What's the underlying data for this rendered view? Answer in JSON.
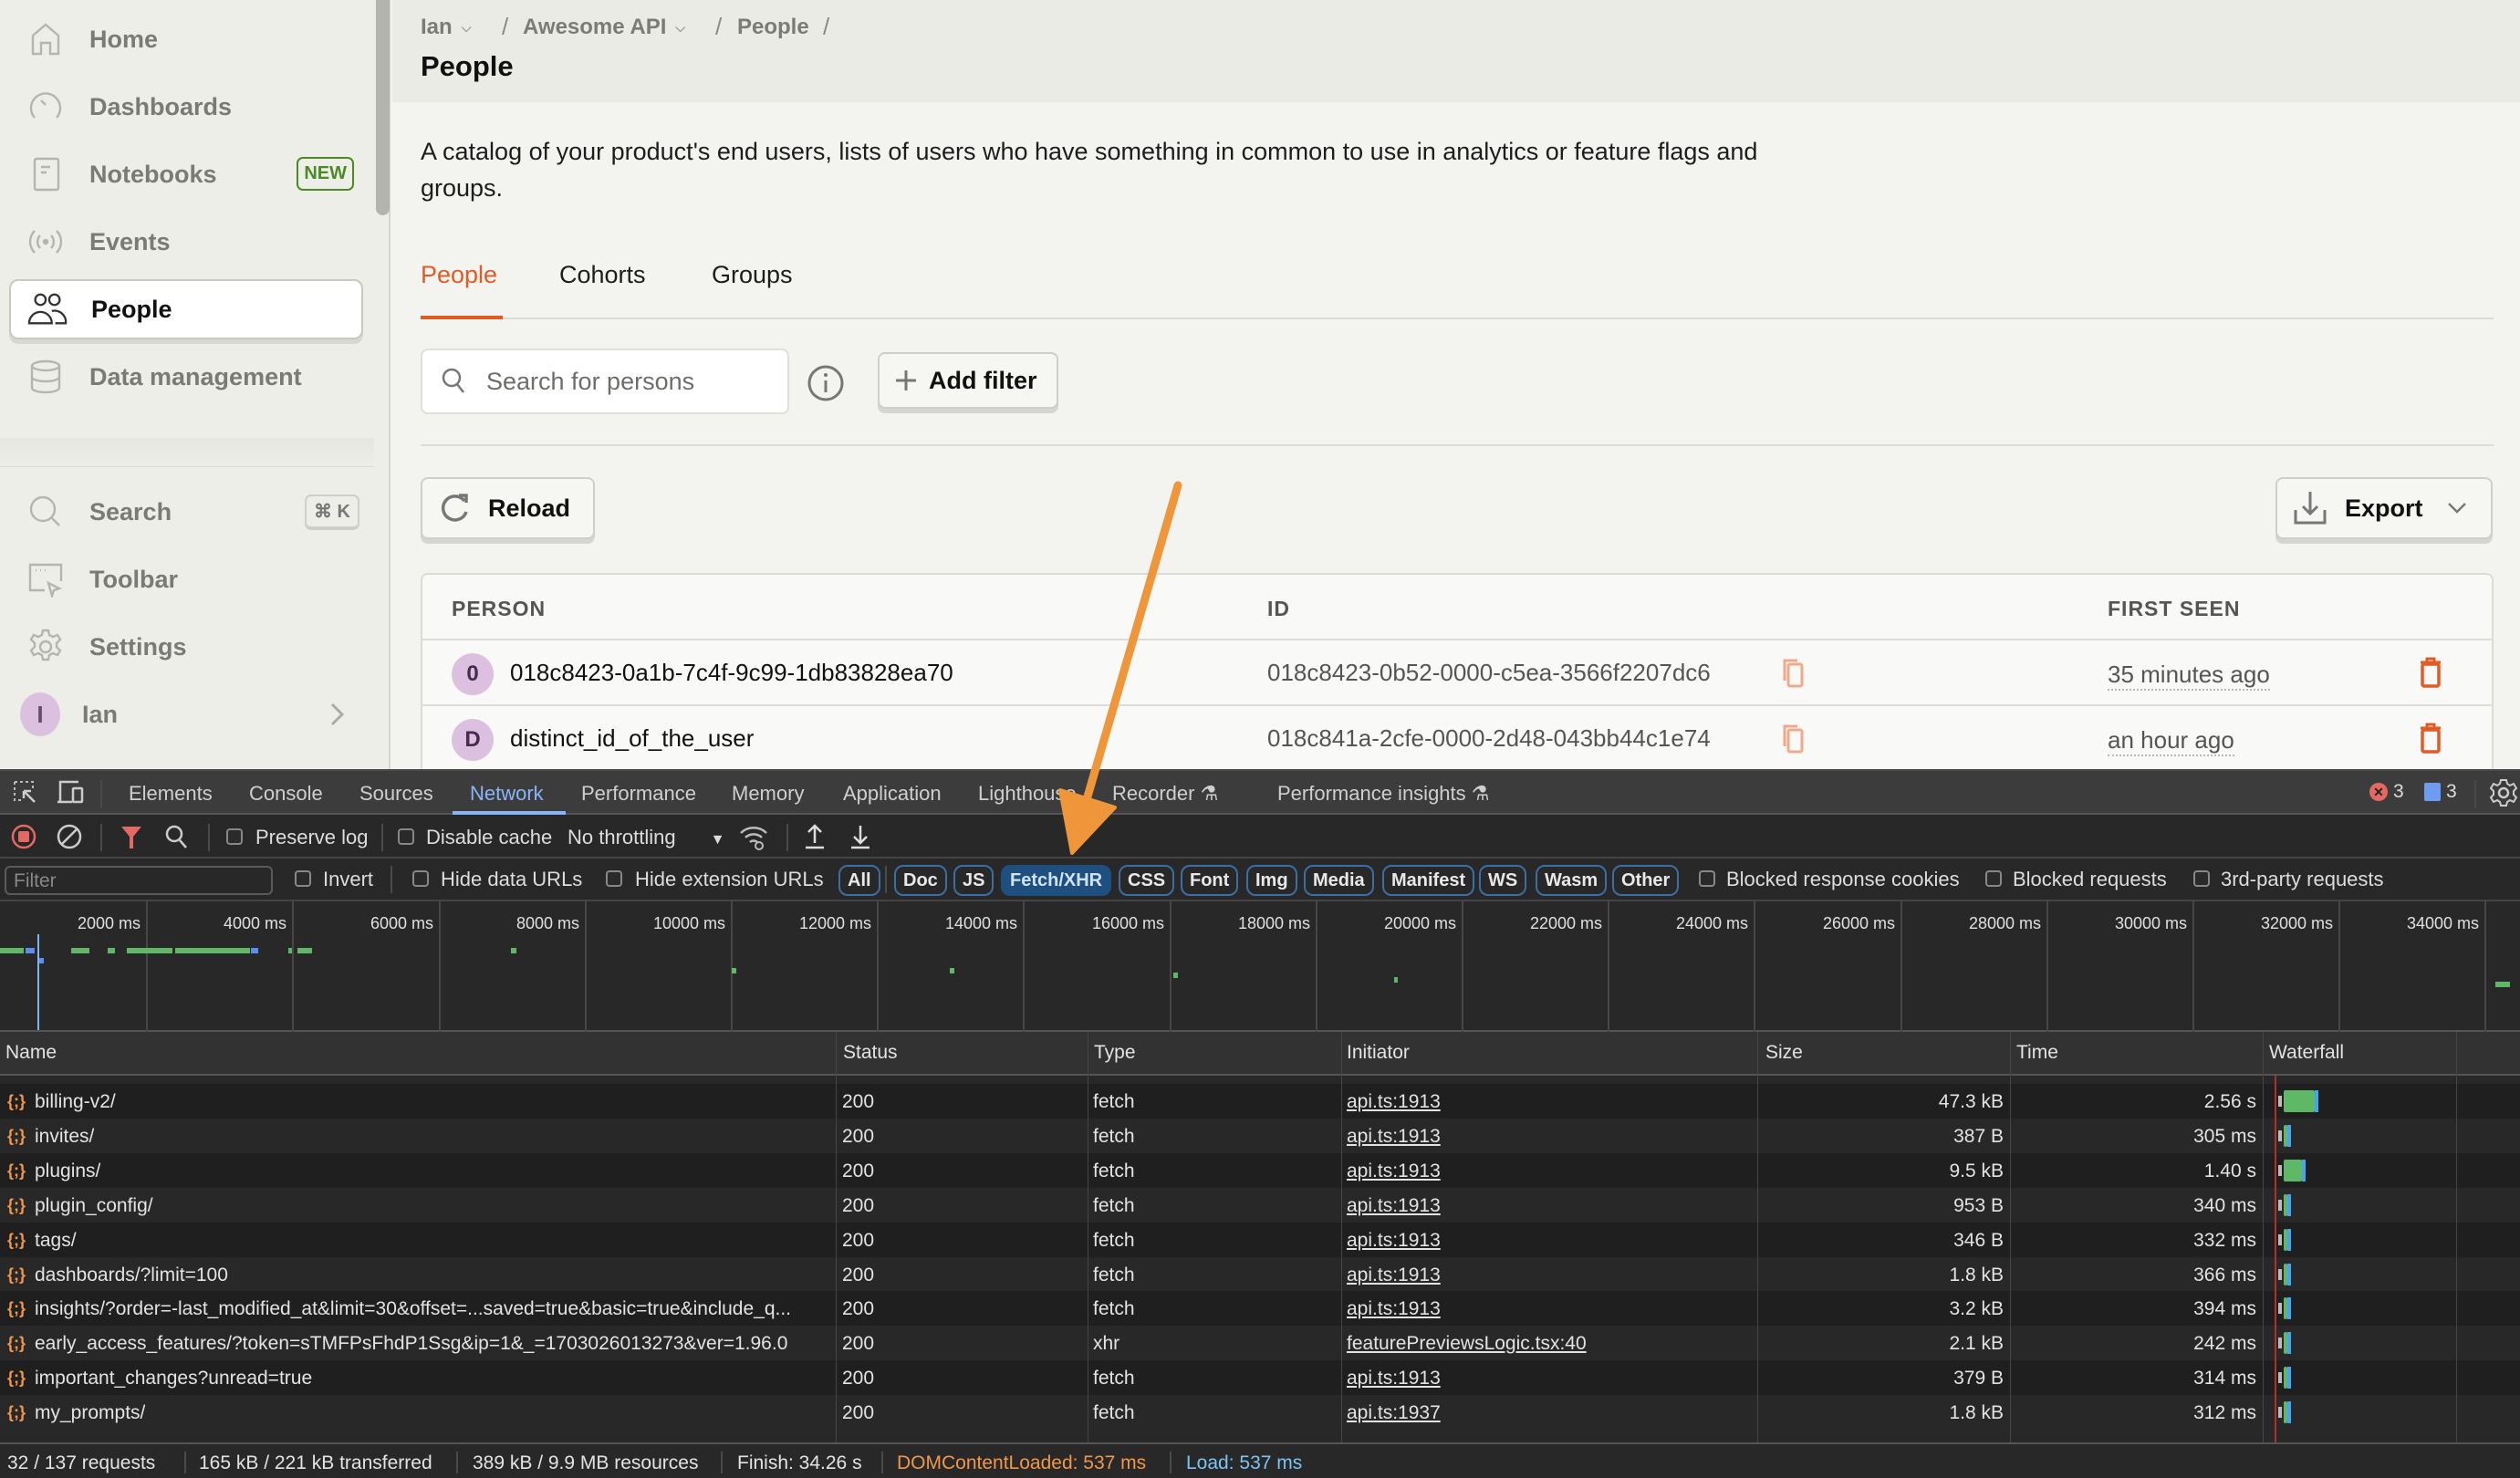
{
  "sidebar": {
    "items": [
      {
        "label": "Home",
        "icon": "home-icon"
      },
      {
        "label": "Dashboards",
        "icon": "gauge-icon"
      },
      {
        "label": "Notebooks",
        "icon": "notebook-icon",
        "badge": "NEW"
      },
      {
        "label": "Events",
        "icon": "broadcast-icon"
      },
      {
        "label": "People",
        "icon": "people-icon",
        "active": true
      },
      {
        "label": "Data management",
        "icon": "database-icon"
      }
    ],
    "bottom_items": [
      {
        "label": "Search",
        "icon": "search-icon",
        "shortcut": "⌘ K"
      },
      {
        "label": "Toolbar",
        "icon": "toolbar-icon"
      },
      {
        "label": "Settings",
        "icon": "gear-icon"
      },
      {
        "label": "Ian",
        "avatar_initial": "I"
      }
    ]
  },
  "breadcrumb": {
    "items": [
      "Ian",
      "Awesome API",
      "People"
    ],
    "separator": "/"
  },
  "page": {
    "title": "People",
    "description": "A catalog of your product's end users, lists of users who have something in common to use in analytics or feature flags and groups.",
    "tabs": [
      {
        "label": "People",
        "active": true
      },
      {
        "label": "Cohorts"
      },
      {
        "label": "Groups"
      }
    ],
    "search_placeholder": "Search for persons",
    "add_filter_label": "Add filter",
    "reload_label": "Reload",
    "export_label": "Export",
    "accent_color": "#e25a26"
  },
  "people_table": {
    "columns": [
      "PERSON",
      "ID",
      "FIRST SEEN"
    ],
    "rows": [
      {
        "initial": "0",
        "person": "018c8423-0a1b-7c4f-9c99-1db83828ea70",
        "id": "018c8423-0b52-0000-c5ea-3566f2207dc6",
        "first_seen": "35 minutes ago"
      },
      {
        "initial": "D",
        "person": "distinct_id_of_the_user",
        "id": "018c841a-2cfe-0000-2d48-043bb44c1e74",
        "first_seen": "an hour ago"
      }
    ]
  },
  "devtools": {
    "tabs": [
      "Elements",
      "Console",
      "Sources",
      "Network",
      "Performance",
      "Memory",
      "Application",
      "Lighthouse",
      "Recorder",
      "Performance insights"
    ],
    "active_tab": "Network",
    "error_count": "3",
    "message_count": "3",
    "toolbar": {
      "preserve_log": "Preserve log",
      "disable_cache": "Disable cache",
      "throttling": "No throttling"
    },
    "filter": {
      "placeholder": "Filter",
      "invert": "Invert",
      "hide_data_urls": "Hide data URLs",
      "hide_extension_urls": "Hide extension URLs",
      "types": [
        "All",
        "Doc",
        "JS",
        "Fetch/XHR",
        "CSS",
        "Font",
        "Img",
        "Media",
        "Manifest",
        "WS",
        "Wasm",
        "Other"
      ],
      "active_type": "Fetch/XHR",
      "blocked_response_cookies": "Blocked response cookies",
      "blocked_requests": "Blocked requests",
      "third_party": "3rd-party requests"
    },
    "overview_ticks": [
      "2000 ms",
      "4000 ms",
      "6000 ms",
      "8000 ms",
      "10000 ms",
      "12000 ms",
      "14000 ms",
      "16000 ms",
      "18000 ms",
      "20000 ms",
      "22000 ms",
      "24000 ms",
      "26000 ms",
      "28000 ms",
      "30000 ms",
      "32000 ms",
      "34000 ms"
    ],
    "columns": [
      "Name",
      "Status",
      "Type",
      "Initiator",
      "Size",
      "Time",
      "Waterfall"
    ],
    "requests": [
      {
        "name": "billing-v2/",
        "status": "200",
        "type": "fetch",
        "initiator": "api.ts:1913",
        "size": "47.3 kB",
        "time": "2.56 s"
      },
      {
        "name": "invites/",
        "status": "200",
        "type": "fetch",
        "initiator": "api.ts:1913",
        "size": "387 B",
        "time": "305 ms"
      },
      {
        "name": "plugins/",
        "status": "200",
        "type": "fetch",
        "initiator": "api.ts:1913",
        "size": "9.5 kB",
        "time": "1.40 s"
      },
      {
        "name": "plugin_config/",
        "status": "200",
        "type": "fetch",
        "initiator": "api.ts:1913",
        "size": "953 B",
        "time": "340 ms"
      },
      {
        "name": "tags/",
        "status": "200",
        "type": "fetch",
        "initiator": "api.ts:1913",
        "size": "346 B",
        "time": "332 ms"
      },
      {
        "name": "dashboards/?limit=100",
        "status": "200",
        "type": "fetch",
        "initiator": "api.ts:1913",
        "size": "1.8 kB",
        "time": "366 ms"
      },
      {
        "name": "insights/?order=-last_modified_at&limit=30&offset=...saved=true&basic=true&include_q...",
        "status": "200",
        "type": "fetch",
        "initiator": "api.ts:1913",
        "size": "3.2 kB",
        "time": "394 ms"
      },
      {
        "name": "early_access_features/?token=sTMFPsFhdP1Ssg&ip=1&_=1703026013273&ver=1.96.0",
        "status": "200",
        "type": "xhr",
        "initiator": "featurePreviewsLogic.tsx:40",
        "size": "2.1 kB",
        "time": "242 ms"
      },
      {
        "name": "important_changes?unread=true",
        "status": "200",
        "type": "fetch",
        "initiator": "api.ts:1913",
        "size": "379 B",
        "time": "314 ms"
      },
      {
        "name": "my_prompts/",
        "status": "200",
        "type": "fetch",
        "initiator": "api.ts:1937",
        "size": "1.8 kB",
        "time": "312 ms"
      }
    ],
    "footer": {
      "requests": "32 / 137 requests",
      "transferred": "165 kB / 221 kB transferred",
      "resources": "389 kB / 9.9 MB resources",
      "finish": "Finish: 34.26 s",
      "dom_content_loaded": "DOMContentLoaded: 537 ms",
      "load": "Load: 537 ms",
      "dcl_color": "#f0974a",
      "load_color": "#7cc4f5"
    }
  },
  "annotation": {
    "arrow_color": "#f0963a",
    "points_to": "Fetch/XHR"
  }
}
